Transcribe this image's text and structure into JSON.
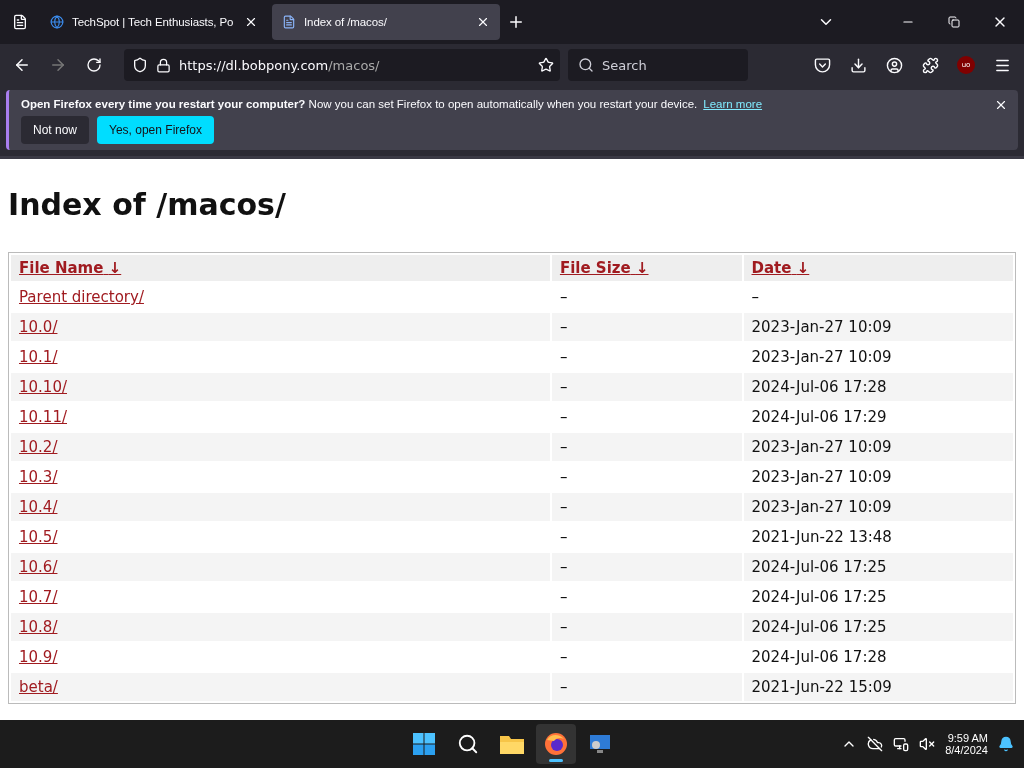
{
  "tabs": [
    {
      "title": "TechSpot | Tech Enthusiasts, Po",
      "selected": false
    },
    {
      "title": "Index of /macos/",
      "selected": true
    }
  ],
  "address": {
    "host": "https://dl.bobpony.com",
    "path": "/macos/"
  },
  "search": {
    "placeholder": "Search"
  },
  "extension_badge": "uo",
  "notification": {
    "text": "**Open Firefox every time you restart your computer?** Now you can set Firefox to open automatically when you restart your device.",
    "link": "Learn more",
    "buttons": [
      {
        "label": "Not now",
        "kind": "secondary"
      },
      {
        "label": "Yes, open Firefox",
        "kind": "primary"
      }
    ]
  },
  "page": {
    "heading": "Index of /macos/",
    "table": {
      "columns": [
        {
          "label": "File Name",
          "sort": "↓"
        },
        {
          "label": "File Size",
          "sort": "↓"
        },
        {
          "label": "Date",
          "sort": "↓"
        }
      ],
      "rows": [
        {
          "name": "Parent directory/",
          "size": "–",
          "date": "–"
        },
        {
          "name": "10.0/",
          "size": "–",
          "date": "2023-Jan-27 10:09"
        },
        {
          "name": "10.1/",
          "size": "–",
          "date": "2023-Jan-27 10:09"
        },
        {
          "name": "10.10/",
          "size": "–",
          "date": "2024-Jul-06 17:28"
        },
        {
          "name": "10.11/",
          "size": "–",
          "date": "2024-Jul-06 17:29"
        },
        {
          "name": "10.2/",
          "size": "–",
          "date": "2023-Jan-27 10:09"
        },
        {
          "name": "10.3/",
          "size": "–",
          "date": "2023-Jan-27 10:09"
        },
        {
          "name": "10.4/",
          "size": "–",
          "date": "2023-Jan-27 10:09"
        },
        {
          "name": "10.5/",
          "size": "–",
          "date": "2021-Jun-22 13:48"
        },
        {
          "name": "10.6/",
          "size": "–",
          "date": "2024-Jul-06 17:25"
        },
        {
          "name": "10.7/",
          "size": "–",
          "date": "2024-Jul-06 17:25"
        },
        {
          "name": "10.8/",
          "size": "–",
          "date": "2024-Jul-06 17:25"
        },
        {
          "name": "10.9/",
          "size": "–",
          "date": "2024-Jul-06 17:28"
        },
        {
          "name": "beta/",
          "size": "–",
          "date": "2021-Jun-22 15:09"
        }
      ]
    }
  },
  "taskbar": {
    "apps": [
      {
        "kind": "start",
        "active": false
      },
      {
        "kind": "search",
        "active": false
      },
      {
        "kind": "files",
        "active": false
      },
      {
        "kind": "browser",
        "active": true
      },
      {
        "kind": "remote",
        "active": false
      }
    ],
    "time": "9:59 AM",
    "date": "8/4/2024"
  }
}
